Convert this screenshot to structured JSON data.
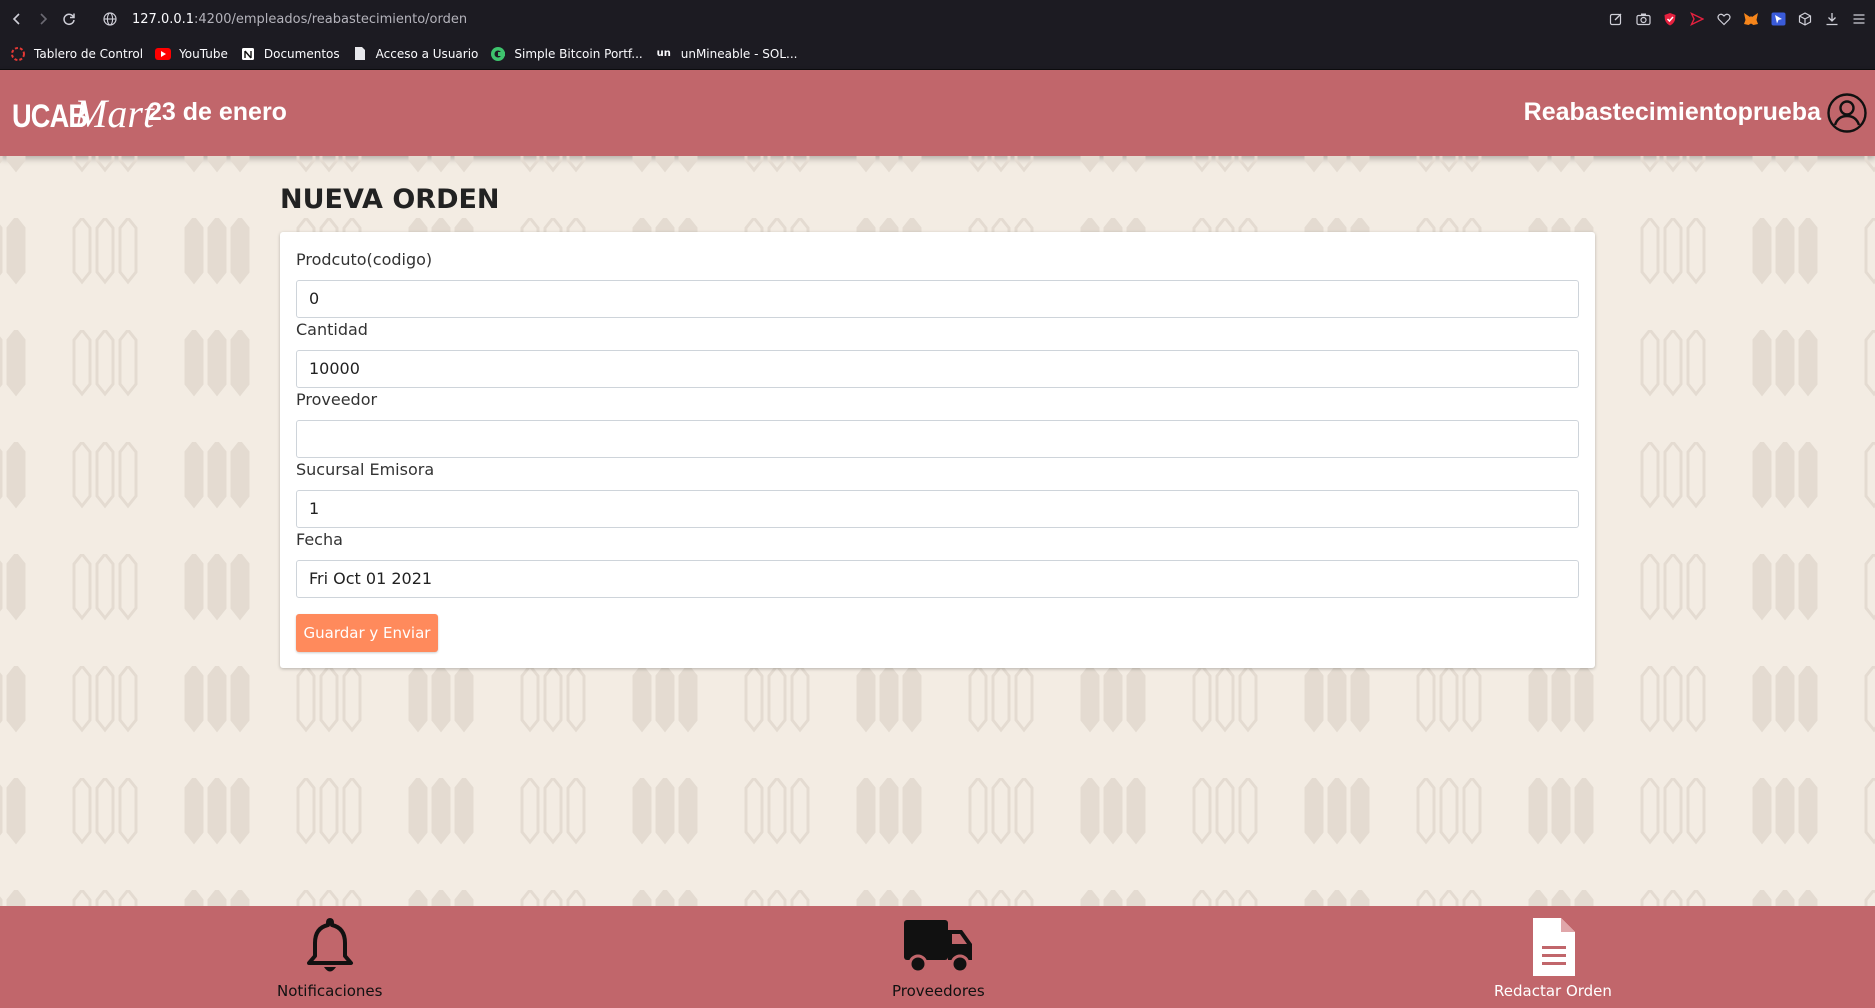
{
  "browser": {
    "url_host": "127.0.0.1",
    "url_path": ":4200/empleados/reabastecimiento/orden",
    "bookmarks": [
      {
        "label": "Tablero de Control",
        "icon": "ring-icon"
      },
      {
        "label": "YouTube",
        "icon": "youtube-icon"
      },
      {
        "label": "Documentos",
        "icon": "notion-icon"
      },
      {
        "label": "Acceso a Usuario",
        "icon": "page-icon"
      },
      {
        "label": "Simple Bitcoin Portf...",
        "icon": "coingecko-icon"
      },
      {
        "label": "unMineable - SOL...",
        "icon": "unmineable-icon"
      }
    ],
    "bookmark_unmineable_prefix": "un"
  },
  "header": {
    "logo_ucab": "UCAB",
    "logo_mart": "Mart",
    "store_name": "23 de enero",
    "username": "Reabastecimientoprueba"
  },
  "form": {
    "title": "NUEVA ORDEN",
    "fields": [
      {
        "label": "Prodcuto(codigo)",
        "value": "0"
      },
      {
        "label": "Cantidad",
        "value": "10000"
      },
      {
        "label": "Proveedor",
        "value": ""
      },
      {
        "label": "Sucursal Emisora",
        "value": "1"
      },
      {
        "label": "Fecha",
        "value": "Fri Oct 01 2021"
      }
    ],
    "submit_label": "Guardar y Enviar"
  },
  "bottom_nav": {
    "items": [
      {
        "label": "Notificaciones",
        "icon": "bell-icon"
      },
      {
        "label": "Proveedores",
        "icon": "truck-icon"
      },
      {
        "label": "Redactar Orden",
        "icon": "document-icon"
      }
    ]
  },
  "colors": {
    "header_bg": "#c1666b",
    "page_bg": "#f3ece3",
    "button_bg": "#ff8a5c",
    "browser_bg": "#1c1b22"
  }
}
